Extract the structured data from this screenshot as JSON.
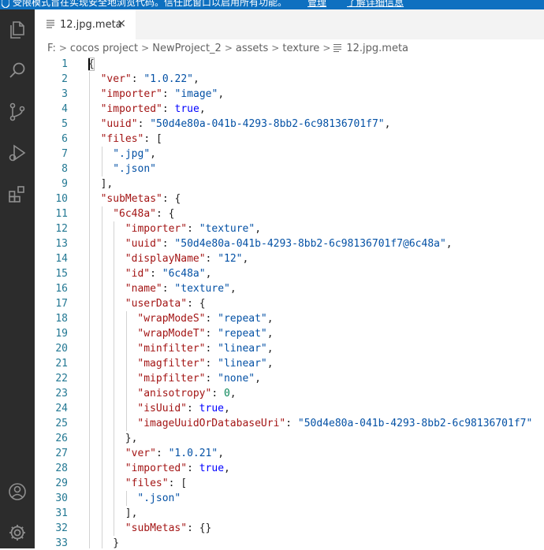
{
  "banner": {
    "message": "受限模式旨在实现安全地浏览代码。信任此窗口以启用所有功能。",
    "manage": "管理",
    "learn_more": "了解详细信息"
  },
  "tab": {
    "label": "12.jpg.meta",
    "close": "×"
  },
  "breadcrumb": {
    "items": [
      "F:",
      "cocos project",
      "NewProject_2",
      "assets",
      "texture",
      "12.jpg.meta"
    ],
    "sep": ">"
  },
  "icons": [
    "explorer-icon",
    "search-icon",
    "source-control-icon",
    "run-debug-icon",
    "extensions-icon",
    "account-icon",
    "gear-icon"
  ],
  "colors": {
    "activity_bar": "#2c2c2c",
    "banner": "#0e70c0",
    "line_number": "#237893",
    "json_key": "#a31515",
    "json_string": "#0451a5",
    "json_keyword": "#0000ff",
    "json_number": "#098658"
  },
  "lines": [
    {
      "n": "1",
      "indent": 0,
      "t": [
        [
          "p",
          "{"
        ]
      ]
    },
    {
      "n": "2",
      "indent": 1,
      "t": [
        [
          "k",
          "\"ver\""
        ],
        [
          "p",
          ": "
        ],
        [
          "s",
          "\"1.0.22\""
        ],
        [
          "p",
          ","
        ]
      ]
    },
    {
      "n": "3",
      "indent": 1,
      "t": [
        [
          "k",
          "\"importer\""
        ],
        [
          "p",
          ": "
        ],
        [
          "s",
          "\"image\""
        ],
        [
          "p",
          ","
        ]
      ]
    },
    {
      "n": "4",
      "indent": 1,
      "t": [
        [
          "k",
          "\"imported\""
        ],
        [
          "p",
          ": "
        ],
        [
          "b",
          "true"
        ],
        [
          "p",
          ","
        ]
      ]
    },
    {
      "n": "5",
      "indent": 1,
      "t": [
        [
          "k",
          "\"uuid\""
        ],
        [
          "p",
          ": "
        ],
        [
          "s",
          "\"50d4e80a-041b-4293-8bb2-6c98136701f7\""
        ],
        [
          "p",
          ","
        ]
      ]
    },
    {
      "n": "6",
      "indent": 1,
      "t": [
        [
          "k",
          "\"files\""
        ],
        [
          "p",
          ": ["
        ]
      ]
    },
    {
      "n": "7",
      "indent": 2,
      "t": [
        [
          "s",
          "\".jpg\""
        ],
        [
          "p",
          ","
        ]
      ]
    },
    {
      "n": "8",
      "indent": 2,
      "t": [
        [
          "s",
          "\".json\""
        ]
      ]
    },
    {
      "n": "9",
      "indent": 1,
      "t": [
        [
          "p",
          "],"
        ]
      ]
    },
    {
      "n": "10",
      "indent": 1,
      "t": [
        [
          "k",
          "\"subMetas\""
        ],
        [
          "p",
          ": {"
        ]
      ]
    },
    {
      "n": "11",
      "indent": 2,
      "t": [
        [
          "k",
          "\"6c48a\""
        ],
        [
          "p",
          ": {"
        ]
      ]
    },
    {
      "n": "12",
      "indent": 3,
      "t": [
        [
          "k",
          "\"importer\""
        ],
        [
          "p",
          ": "
        ],
        [
          "s",
          "\"texture\""
        ],
        [
          "p",
          ","
        ]
      ]
    },
    {
      "n": "13",
      "indent": 3,
      "t": [
        [
          "k",
          "\"uuid\""
        ],
        [
          "p",
          ": "
        ],
        [
          "s",
          "\"50d4e80a-041b-4293-8bb2-6c98136701f7@6c48a\""
        ],
        [
          "p",
          ","
        ]
      ]
    },
    {
      "n": "14",
      "indent": 3,
      "t": [
        [
          "k",
          "\"displayName\""
        ],
        [
          "p",
          ": "
        ],
        [
          "s",
          "\"12\""
        ],
        [
          "p",
          ","
        ]
      ]
    },
    {
      "n": "15",
      "indent": 3,
      "t": [
        [
          "k",
          "\"id\""
        ],
        [
          "p",
          ": "
        ],
        [
          "s",
          "\"6c48a\""
        ],
        [
          "p",
          ","
        ]
      ]
    },
    {
      "n": "16",
      "indent": 3,
      "t": [
        [
          "k",
          "\"name\""
        ],
        [
          "p",
          ": "
        ],
        [
          "s",
          "\"texture\""
        ],
        [
          "p",
          ","
        ]
      ]
    },
    {
      "n": "17",
      "indent": 3,
      "t": [
        [
          "k",
          "\"userData\""
        ],
        [
          "p",
          ": {"
        ]
      ]
    },
    {
      "n": "18",
      "indent": 4,
      "t": [
        [
          "k",
          "\"wrapModeS\""
        ],
        [
          "p",
          ": "
        ],
        [
          "s",
          "\"repeat\""
        ],
        [
          "p",
          ","
        ]
      ]
    },
    {
      "n": "19",
      "indent": 4,
      "t": [
        [
          "k",
          "\"wrapModeT\""
        ],
        [
          "p",
          ": "
        ],
        [
          "s",
          "\"repeat\""
        ],
        [
          "p",
          ","
        ]
      ]
    },
    {
      "n": "20",
      "indent": 4,
      "t": [
        [
          "k",
          "\"minfilter\""
        ],
        [
          "p",
          ": "
        ],
        [
          "s",
          "\"linear\""
        ],
        [
          "p",
          ","
        ]
      ]
    },
    {
      "n": "21",
      "indent": 4,
      "t": [
        [
          "k",
          "\"magfilter\""
        ],
        [
          "p",
          ": "
        ],
        [
          "s",
          "\"linear\""
        ],
        [
          "p",
          ","
        ]
      ]
    },
    {
      "n": "22",
      "indent": 4,
      "t": [
        [
          "k",
          "\"mipfilter\""
        ],
        [
          "p",
          ": "
        ],
        [
          "s",
          "\"none\""
        ],
        [
          "p",
          ","
        ]
      ]
    },
    {
      "n": "23",
      "indent": 4,
      "t": [
        [
          "k",
          "\"anisotropy\""
        ],
        [
          "p",
          ": "
        ],
        [
          "n",
          "0"
        ],
        [
          "p",
          ","
        ]
      ]
    },
    {
      "n": "24",
      "indent": 4,
      "t": [
        [
          "k",
          "\"isUuid\""
        ],
        [
          "p",
          ": "
        ],
        [
          "b",
          "true"
        ],
        [
          "p",
          ","
        ]
      ]
    },
    {
      "n": "25",
      "indent": 4,
      "t": [
        [
          "k",
          "\"imageUuidOrDatabaseUri\""
        ],
        [
          "p",
          ": "
        ],
        [
          "s",
          "\"50d4e80a-041b-4293-8bb2-6c98136701f7\""
        ]
      ]
    },
    {
      "n": "26",
      "indent": 3,
      "t": [
        [
          "p",
          "},"
        ]
      ]
    },
    {
      "n": "27",
      "indent": 3,
      "t": [
        [
          "k",
          "\"ver\""
        ],
        [
          "p",
          ": "
        ],
        [
          "s",
          "\"1.0.21\""
        ],
        [
          "p",
          ","
        ]
      ]
    },
    {
      "n": "28",
      "indent": 3,
      "t": [
        [
          "k",
          "\"imported\""
        ],
        [
          "p",
          ": "
        ],
        [
          "b",
          "true"
        ],
        [
          "p",
          ","
        ]
      ]
    },
    {
      "n": "29",
      "indent": 3,
      "t": [
        [
          "k",
          "\"files\""
        ],
        [
          "p",
          ": ["
        ]
      ]
    },
    {
      "n": "30",
      "indent": 4,
      "t": [
        [
          "s",
          "\".json\""
        ]
      ]
    },
    {
      "n": "31",
      "indent": 3,
      "t": [
        [
          "p",
          "],"
        ]
      ]
    },
    {
      "n": "32",
      "indent": 3,
      "t": [
        [
          "k",
          "\"subMetas\""
        ],
        [
          "p",
          ": {}"
        ]
      ]
    },
    {
      "n": "33",
      "indent": 2,
      "t": [
        [
          "p",
          "}"
        ]
      ]
    }
  ]
}
